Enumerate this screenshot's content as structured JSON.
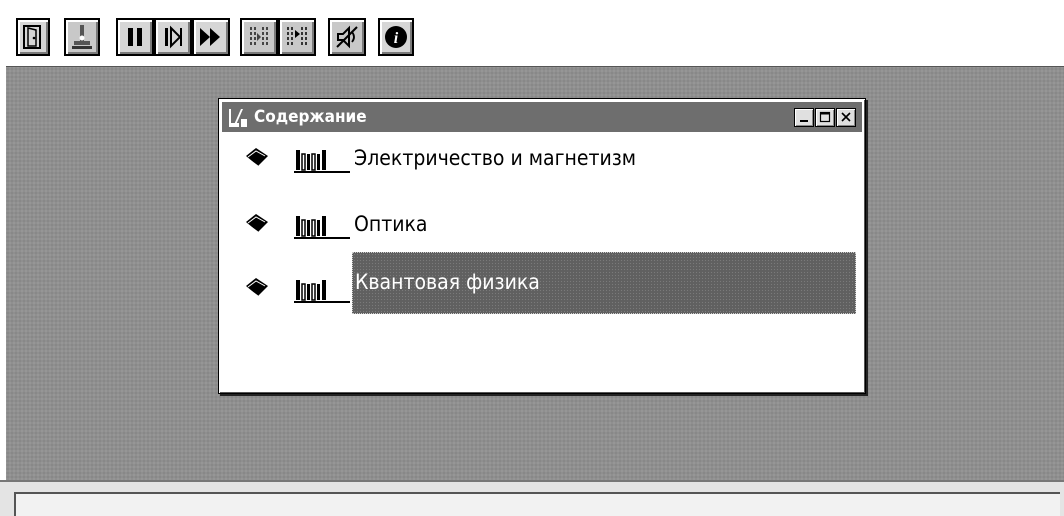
{
  "toolbar": {
    "buttons": [
      {
        "icon": "exit-door-icon"
      },
      {
        "icon": "lab-flask-icon"
      },
      {
        "icon": "pause-icon"
      },
      {
        "icon": "step-forward-icon"
      },
      {
        "icon": "fast-forward-icon"
      },
      {
        "icon": "columns-icon"
      },
      {
        "icon": "columns-play-icon"
      },
      {
        "icon": "mute-sound-icon"
      },
      {
        "icon": "info-icon"
      }
    ]
  },
  "window": {
    "title": "Содержание",
    "controls": {
      "minimize": "minimize",
      "maximize": "maximize",
      "close": "close"
    }
  },
  "contents": {
    "items": [
      {
        "label": "Электричество и магнетизм",
        "selected": false
      },
      {
        "label": "Оптика",
        "selected": false
      },
      {
        "label": "Квантовая физика",
        "selected": true
      }
    ]
  },
  "statusbar": {
    "text": ""
  },
  "colors": {
    "titlebar": "#6e6e6e",
    "workspace": "#8f8f8f",
    "selection": "#606060"
  }
}
